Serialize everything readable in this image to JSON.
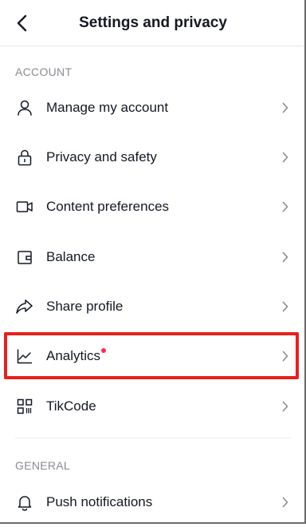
{
  "header": {
    "title": "Settings and privacy",
    "back_icon": "chevron-left-icon"
  },
  "sections": {
    "account": {
      "label": "ACCOUNT",
      "items": [
        {
          "label": "Manage my account",
          "icon": "person-icon"
        },
        {
          "label": "Privacy and safety",
          "icon": "lock-icon"
        },
        {
          "label": "Content preferences",
          "icon": "video-camera-icon"
        },
        {
          "label": "Balance",
          "icon": "wallet-icon"
        },
        {
          "label": "Share profile",
          "icon": "share-arrow-icon"
        },
        {
          "label": "Analytics",
          "icon": "line-chart-icon",
          "notification_dot": true
        },
        {
          "label": "TikCode",
          "icon": "qr-code-icon"
        }
      ]
    },
    "general": {
      "label": "GENERAL",
      "items": [
        {
          "label": "Push notifications",
          "icon": "bell-icon"
        }
      ]
    }
  },
  "colors": {
    "text": "#161823",
    "secondary_text": "#8a8b91",
    "notification_dot": "#fe2c55",
    "highlight_box": "#e8201a"
  }
}
